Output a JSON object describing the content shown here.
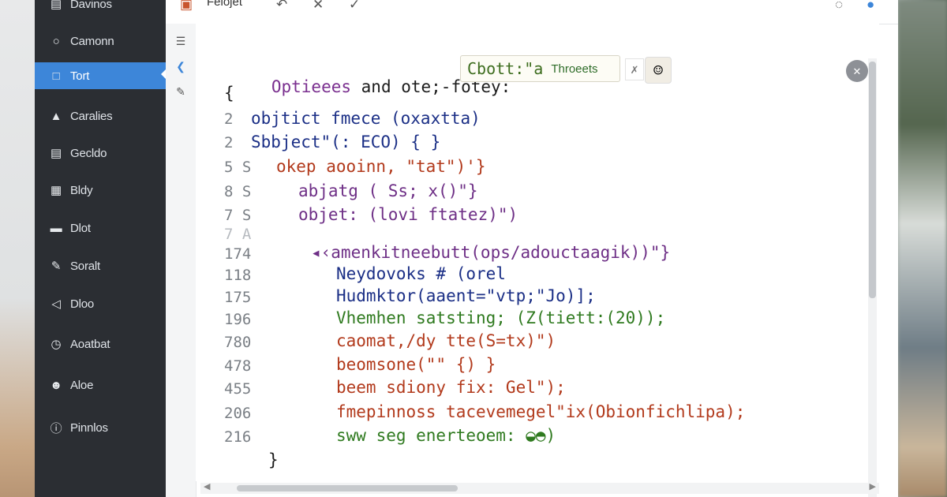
{
  "sidebar": {
    "items": [
      {
        "label": "Davinos",
        "icon": "folder-icon"
      },
      {
        "label": "Camonn",
        "icon": "circle-icon"
      },
      {
        "label": "Tort",
        "icon": "square-icon",
        "active": true
      },
      {
        "label": "Caralies",
        "icon": "home-icon"
      },
      {
        "label": "Gecldo",
        "icon": "grid-icon"
      },
      {
        "label": "Bldy",
        "icon": "list-icon"
      },
      {
        "label": "Dlot",
        "icon": "bar-icon"
      },
      {
        "label": "Soralt",
        "icon": "pen-icon"
      },
      {
        "label": "Dloo",
        "icon": "back-icon"
      },
      {
        "label": "Aoatbat",
        "icon": "clock-icon"
      },
      {
        "label": "Aloe",
        "icon": "user-icon"
      },
      {
        "label": "Pinnlos",
        "icon": "info-icon"
      }
    ]
  },
  "topbar": {
    "tab_label": "Felojet"
  },
  "hint": {
    "prefix_purple": "Optieees",
    "prefix_rest": " and ote;-fotey:",
    "box_code": "Cbott:\"a",
    "box_small": "Throeets"
  },
  "code": {
    "lines": [
      {
        "n": "",
        "t": "{"
      },
      {
        "n": "2",
        "t": "objtict fmece (oxaxtta)"
      },
      {
        "n": "2",
        "t": "Sbbject\"(: ECO) { }"
      },
      {
        "n": "5 S",
        "t": "okep aooinn, \"tat\")'}"
      },
      {
        "n": "8 S",
        "t": "abjatg ( Ss; x()\"}"
      },
      {
        "n": "7 S",
        "t": "objet: (lovi ftatez)\")"
      },
      {
        "n": "7 A",
        "t": ""
      },
      {
        "n": "174",
        "t": "◂‹amenkitneebutt(ops/adouctaagik))\"}"
      },
      {
        "n": "118",
        "t": "Neydovoks # (orel"
      },
      {
        "n": "175",
        "t": "Hudmktor(aaent=\"vtp;\"Jo)];"
      },
      {
        "n": "196",
        "t": "Vhemhen satsting; (Z(tiett:(20));"
      },
      {
        "n": "780",
        "t": "caomat,/dy tte(S=tx)\")"
      },
      {
        "n": "478",
        "t": "beomsone(\"\" {) }"
      },
      {
        "n": "455",
        "t": "beem sdiony fix: Gel\");"
      },
      {
        "n": "206",
        "t": "fmepinnoss tacevemegel\"ix(Obionfichlipa);"
      },
      {
        "n": "216",
        "t": "sww seg enerteoem: ◒◓)"
      },
      {
        "n": "",
        "t": "}"
      }
    ]
  },
  "colors": {
    "sidebar_bg": "#2b2e33",
    "active_item": "#3d86d9",
    "purple": "#7a2f8f",
    "blue": "#1b2f86",
    "red": "#b23a1c",
    "green": "#2f7a1f"
  }
}
